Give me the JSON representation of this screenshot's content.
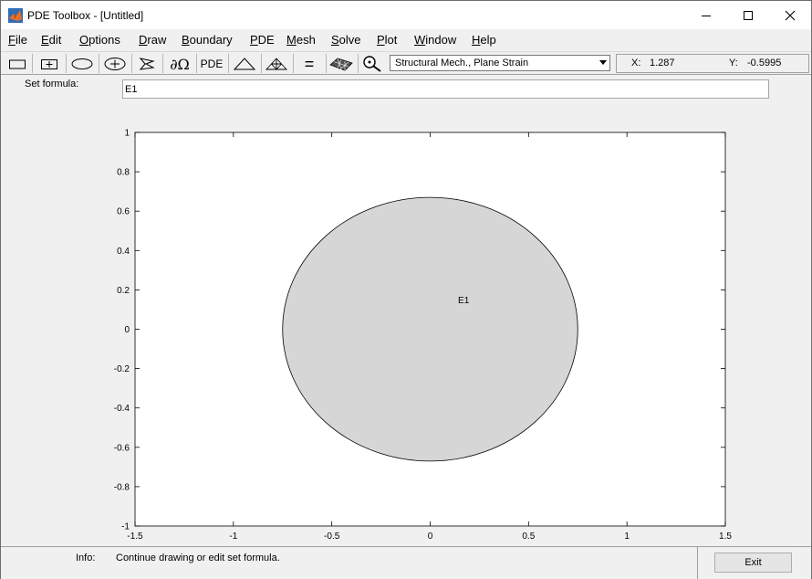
{
  "window": {
    "title": "PDE Toolbox - [Untitled]"
  },
  "menu": [
    {
      "label": "File",
      "key": "F"
    },
    {
      "label": "Edit",
      "key": "E"
    },
    {
      "label": "Options",
      "key": "O"
    },
    {
      "label": "Draw",
      "key": "D"
    },
    {
      "label": "Boundary",
      "key": "B"
    },
    {
      "label": "PDE",
      "key": "P"
    },
    {
      "label": "Mesh",
      "key": "M"
    },
    {
      "label": "Solve",
      "key": "S"
    },
    {
      "label": "Plot",
      "key": "P"
    },
    {
      "label": "Window",
      "key": "W"
    },
    {
      "label": "Help",
      "key": "H"
    }
  ],
  "toolbar": {
    "boundary_mode_symbol": "∂Ω",
    "pde_label": "PDE",
    "equals_symbol": "=",
    "application_mode": "Structural Mech., Plane Strain",
    "icons": [
      "rectangle-icon",
      "centered-rectangle-icon",
      "ellipse-icon",
      "centered-ellipse-icon",
      "polygon-icon",
      "boundary-mode-icon",
      "pde-specification-icon",
      "init-mesh-icon",
      "refine-mesh-icon",
      "solve-icon",
      "plot-icon",
      "zoom-icon"
    ]
  },
  "coords": {
    "x_label": "X:",
    "x_value": "1.287",
    "y_label": "Y:",
    "y_value": "-0.5995"
  },
  "formula": {
    "label": "Set formula:",
    "value": "E1"
  },
  "plot": {
    "x_ticks": [
      "-1.5",
      "-1",
      "-0.5",
      "0",
      "0.5",
      "1",
      "1.5"
    ],
    "y_ticks": [
      "1",
      "0.8",
      "0.6",
      "0.4",
      "0.2",
      "0",
      "-0.2",
      "-0.4",
      "-0.6",
      "-0.8",
      "-1"
    ],
    "xlim": [
      -1.5,
      1.5
    ],
    "ylim": [
      -1,
      1
    ],
    "shape": {
      "type": "ellipse",
      "label": "E1",
      "center": [
        0,
        0
      ],
      "x_radius": 0.75,
      "y_radius": 0.67,
      "label_at": [
        0.17,
        0.15
      ],
      "fill": "#d6d6d6"
    }
  },
  "status": {
    "info_label": "Info:",
    "info_text": "Continue drawing or edit set formula.",
    "exit_label": "Exit"
  }
}
